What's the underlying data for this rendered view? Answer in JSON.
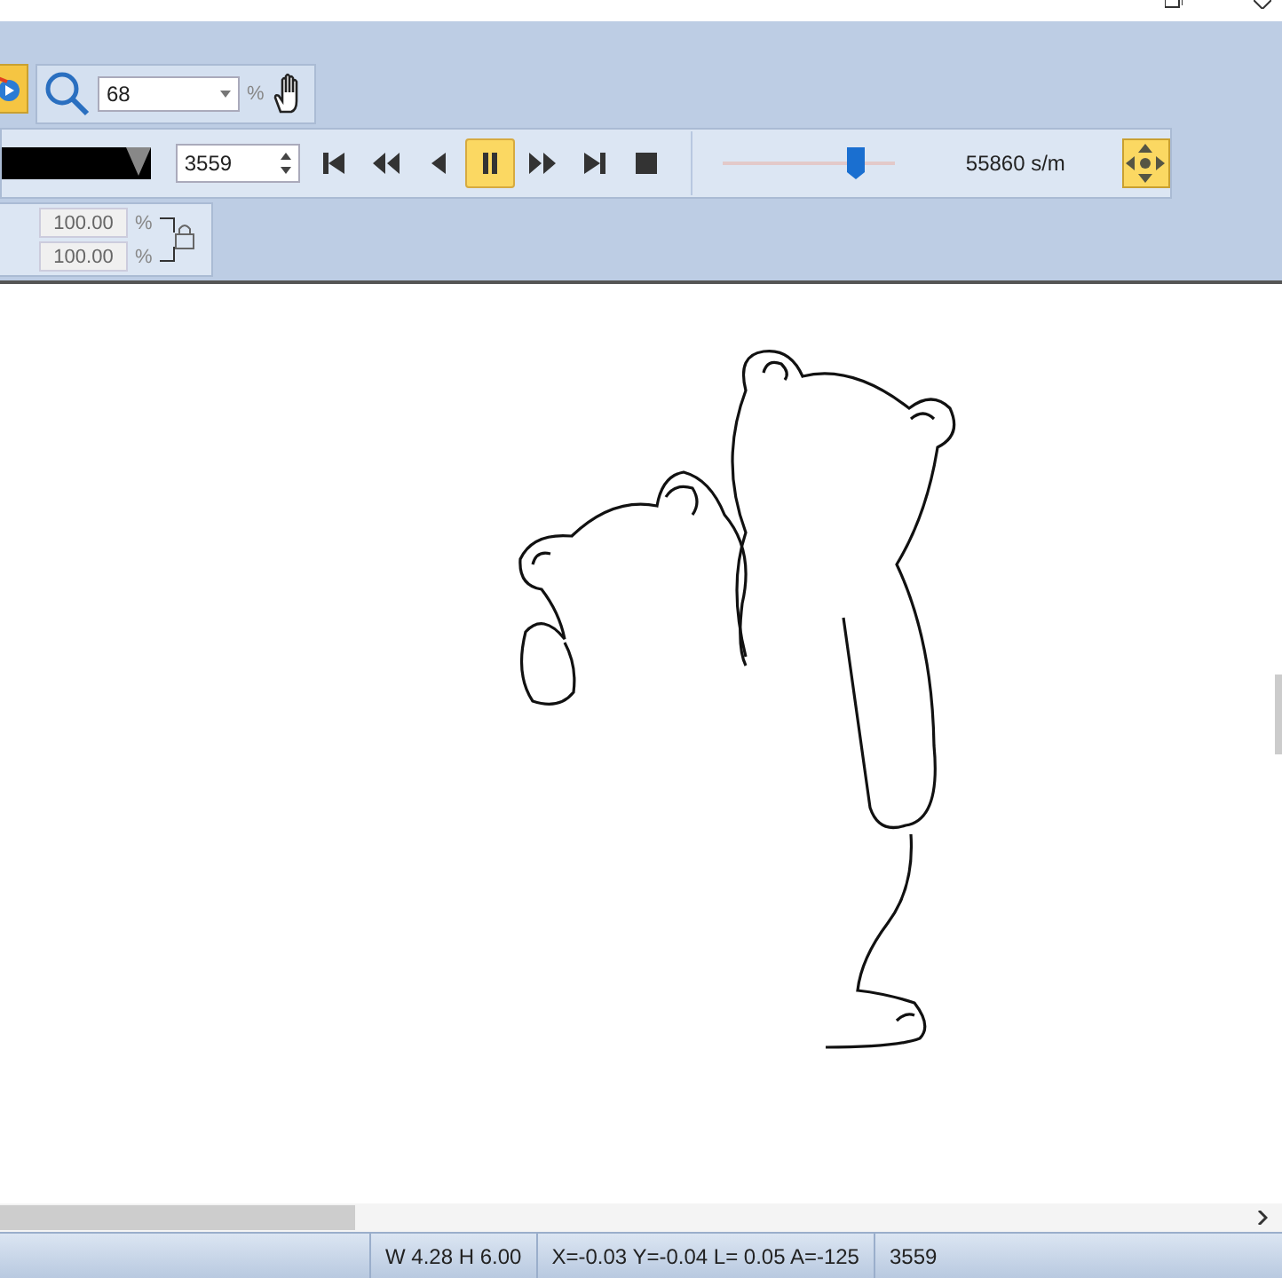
{
  "zoom_toolbar": {
    "zoom_value": "68",
    "zoom_unit": "%"
  },
  "playback": {
    "frame": "3559",
    "controls": [
      {
        "kind": "first",
        "selected": false
      },
      {
        "kind": "rewind",
        "selected": false
      },
      {
        "kind": "back",
        "selected": false
      },
      {
        "kind": "pause",
        "selected": true
      },
      {
        "kind": "forward",
        "selected": false
      },
      {
        "kind": "last",
        "selected": false
      },
      {
        "kind": "stop",
        "selected": false
      }
    ],
    "speed_slider": {
      "level": 0.77
    },
    "speed": "55860 s/m"
  },
  "scale": {
    "fields": [
      {
        "value": "100.00",
        "unit": "%"
      },
      {
        "value": "100.00",
        "unit": "%"
      }
    ]
  },
  "status_bar": [
    "W 4.28 H 6.00",
    "X=-0.03 Y=-0.04 L= 0.05 A=-125",
    "3559"
  ]
}
